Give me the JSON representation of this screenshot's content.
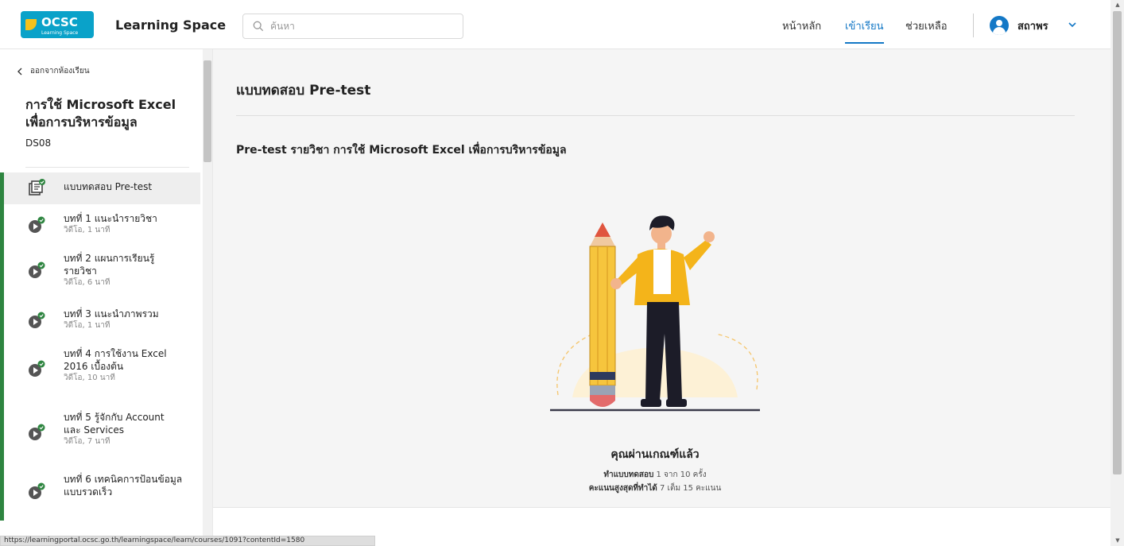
{
  "header": {
    "logo_text": "OCSC",
    "logo_sub": "Learning Space",
    "app_title": "Learning Space",
    "search_placeholder": "ค้นหา",
    "nav": [
      "หน้าหลัก",
      "เข้าเรียน",
      "ช่วยเหลือ"
    ],
    "active_nav": "เข้าเรียน",
    "username": "สถาพร",
    "accent": "#1478c6"
  },
  "sidebar": {
    "back_label": "ออกจากห้องเรียน",
    "course_title": "การใช้ Microsoft Excel เพื่อการบริหารข้อมูล",
    "course_code": "DS08",
    "lessons": [
      {
        "name": "แบบทดสอบ Pre-test",
        "meta": "",
        "icon": "quiz-icon",
        "active": true
      },
      {
        "name": "บทที่ 1 แนะนำรายวิชา",
        "meta": "วิดีโอ, 1 นาที",
        "icon": "video-play-icon"
      },
      {
        "name": "บทที่ 2 แผนการเรียนรู้รายวิชา",
        "meta": "วิดีโอ, 6 นาที",
        "icon": "video-play-icon"
      },
      {
        "name": "บทที่ 3 แนะนำภาพรวม",
        "meta": "วิดีโอ, 1 นาที",
        "icon": "video-play-icon"
      },
      {
        "name": "บทที่ 4 การใช้งาน Excel 2016 เบื้องต้น",
        "meta": "วิดีโอ, 10 นาที",
        "icon": "video-play-icon"
      },
      {
        "name": "บทที่ 5 รู้จักกับ Account และ Services",
        "meta": "วิดีโอ, 7 นาที",
        "icon": "video-play-icon"
      },
      {
        "name": "บทที่ 6 เทคนิคการป้อนข้อมูลแบบรวดเร็ว",
        "meta": "",
        "icon": "video-play-icon"
      }
    ],
    "completed_color": "#2e8540"
  },
  "main": {
    "title": "แบบทดสอบ Pre-test",
    "quiz_title": "Pre-test รายวิชา การใช้ Microsoft Excel เพื่อการบริหารข้อมูล",
    "pass_text": "คุณผ่านเกณฑ์แล้ว",
    "attempt_label": "ทำแบบทดสอบ",
    "attempt_value": "1 จาก 10 ครั้ง",
    "score_label": "คะแนนสูงสุดที่ทำได้",
    "score_value": "7 เต็ม 15 คะแนน"
  },
  "status_bar": {
    "url": "https://learningportal.ocsc.go.th/learningspace/learn/courses/1091?contentId=1580"
  }
}
